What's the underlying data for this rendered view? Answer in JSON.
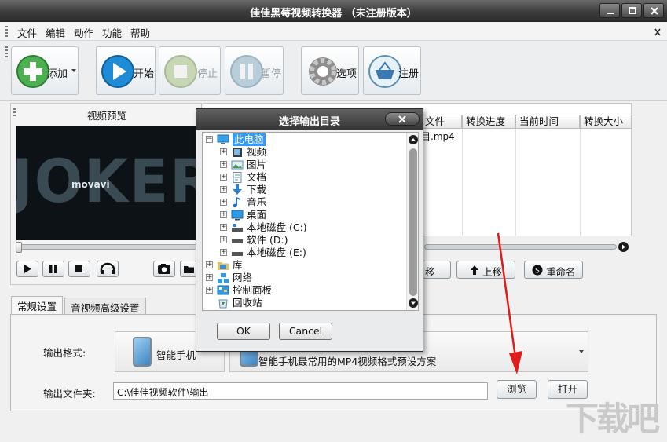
{
  "window": {
    "title": "佳佳黑莓视频转换器 （未注册版本）"
  },
  "menu": [
    "文件",
    "编辑",
    "动作",
    "功能",
    "帮助"
  ],
  "toolbar": {
    "add": "添加",
    "start": "开始",
    "stop": "停止",
    "pause": "暂停",
    "options": "选项",
    "register": "注册"
  },
  "preview": {
    "title": "视频预览",
    "video_text": "JOKER",
    "watermark": "movavi"
  },
  "file_list": {
    "columns": [
      "文件",
      "转换进度",
      "当前时间",
      "转换大小"
    ],
    "rows": [
      {
        "file": "目.mp4"
      }
    ],
    "buttons": {
      "remove": "移",
      "move_up": "上移",
      "rename": "重命名"
    }
  },
  "tabs": [
    "常规设置",
    "音视频高级设置"
  ],
  "settings": {
    "format_label": "输出格式:",
    "format_device": "智能手机",
    "format_desc": "智能手机最常用的MP4视频格式预设方案",
    "folder_label": "输出文件夹:",
    "folder_value": "C:\\佳佳视频软件\\输出",
    "browse": "浏览",
    "open": "打开"
  },
  "dialog": {
    "title": "选择输出目录",
    "tree": {
      "root": "此电脑",
      "children": [
        "视频",
        "图片",
        "文档",
        "下载",
        "音乐",
        "桌面",
        "本地磁盘 (C:)",
        "软件 (D:)",
        "本地磁盘 (E:)"
      ],
      "siblings": [
        "库",
        "网络",
        "控制面板",
        "回收站"
      ]
    },
    "ok": "OK",
    "cancel": "Cancel"
  },
  "logo": "下载吧",
  "colors": {
    "accent_arrow": "#e01b1b",
    "title_bar": "#3c3c3c"
  }
}
